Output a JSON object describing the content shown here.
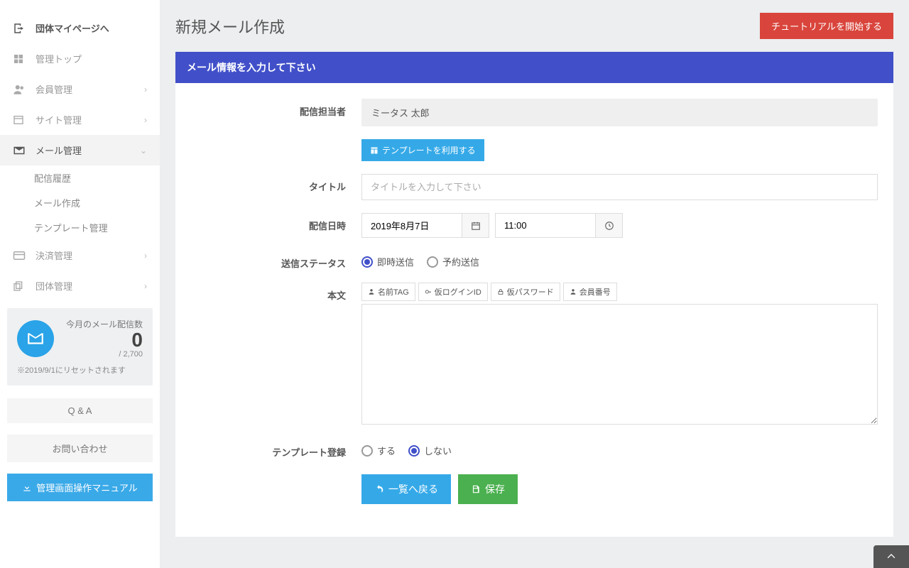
{
  "sidebar": {
    "items": [
      {
        "icon": "box-arrow",
        "label": "団体マイページへ",
        "bold": true
      },
      {
        "icon": "grid",
        "label": "管理トップ"
      },
      {
        "icon": "people",
        "label": "会員管理",
        "chev": ">"
      },
      {
        "icon": "window",
        "label": "サイト管理",
        "chev": ">"
      },
      {
        "icon": "mail",
        "label": "メール管理",
        "chev": "v",
        "active": true
      },
      {
        "icon": "card",
        "label": "決済管理",
        "chev": ">"
      },
      {
        "icon": "copy",
        "label": "団体管理",
        "chev": ">"
      }
    ],
    "sub": [
      "配信履歴",
      "メール作成",
      "テンプレート管理"
    ],
    "stats": {
      "label": "今月のメール配信数",
      "count": "0",
      "total": "/ 2,700",
      "note": "※2019/9/1にリセットされます"
    },
    "qa": "Q & A",
    "contact": "お問い合わせ",
    "manual": "管理画面操作マニュアル"
  },
  "page": {
    "title": "新規メール作成",
    "tutorial": "チュートリアルを開始する"
  },
  "panel": {
    "header": "メール情報を入力して下さい"
  },
  "form": {
    "sender_label": "配信担当者",
    "sender_value": "ミータス 太郎",
    "template_btn": "テンプレートを利用する",
    "title_label": "タイトル",
    "title_placeholder": "タイトルを入力して下さい",
    "datetime_label": "配信日時",
    "date_value": "2019年8月7日",
    "time_value": "11:00",
    "status_label": "送信ステータス",
    "status_opts": [
      "即時送信",
      "予約送信"
    ],
    "body_label": "本文",
    "tags": [
      "名前TAG",
      "仮ログインID",
      "仮パスワード",
      "会員番号"
    ],
    "tpl_reg_label": "テンプレート登録",
    "tpl_reg_opts": [
      "する",
      "しない"
    ],
    "back_btn": "一覧へ戻る",
    "save_btn": "保存"
  }
}
